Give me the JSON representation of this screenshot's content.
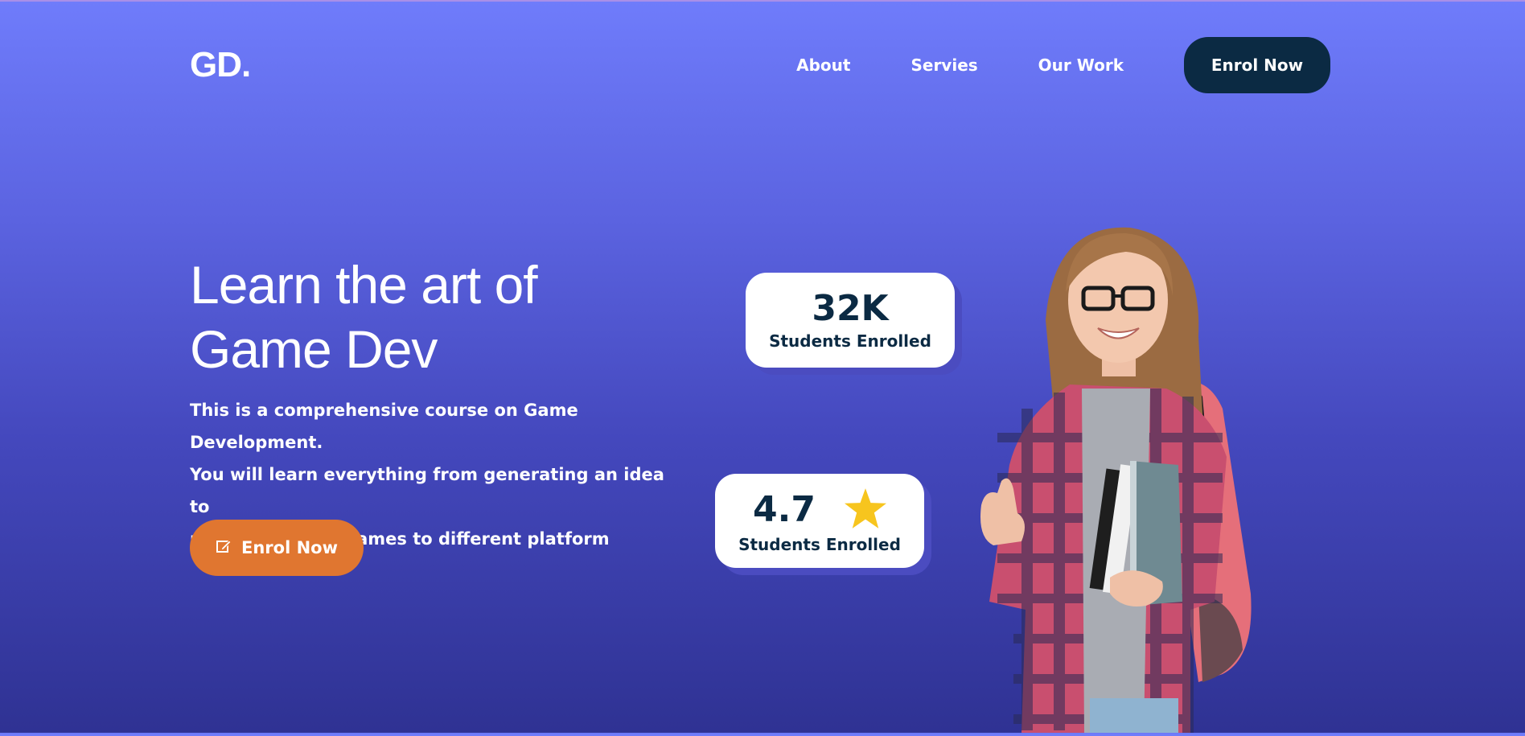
{
  "header": {
    "logo": "GD.",
    "nav": [
      "About",
      "Servies",
      "Our Work"
    ],
    "cta_label": "Enrol Now"
  },
  "hero": {
    "headline_line1": "Learn the art of",
    "headline_line2": "Game Dev",
    "desc_line1": "This is a comprehensive course on Game Development.",
    "desc_line2": "You will learn everything from generating an idea to",
    "desc_line3": "publishing your games to different platform",
    "button_label": "Enrol Now",
    "button_icon": "edit-icon"
  },
  "stats": [
    {
      "value": "32K",
      "label": "Students Enrolled"
    },
    {
      "value": "4.7",
      "label": "Students Enrolled",
      "icon": "star-icon"
    }
  ],
  "colors": {
    "gradient_top": "#6f7cfb",
    "gradient_bottom": "#2f3293",
    "nav_cta": "#0b2a43",
    "hero_button": "#e07630",
    "star": "#f7c51e",
    "card_text": "#0b2a43"
  }
}
